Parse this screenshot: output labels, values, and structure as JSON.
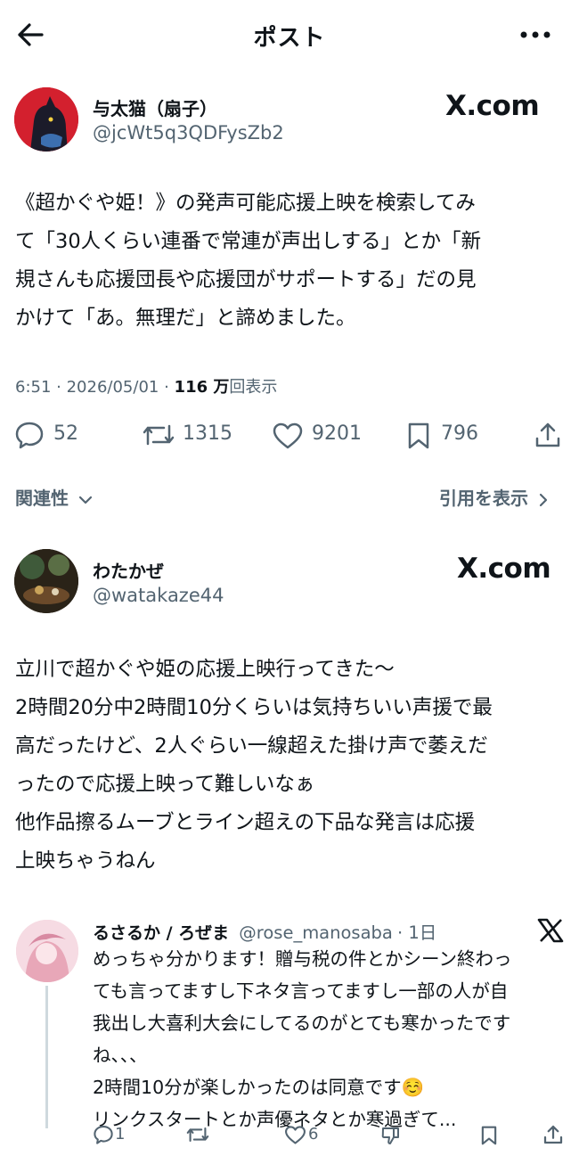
{
  "header": {
    "title": "ポスト"
  },
  "post": {
    "author": {
      "name": "与太猫（扇子）",
      "handle": "@jcWt5q3QDFysZb2"
    },
    "brand": "X.com",
    "lines": [
      "《超かぐや姫！》の発声可能応援上映を検索してみ",
      "て「30人くらい連番で常連が声出しする」とか「新",
      "規さんも応援団長や応援団がサポートする」だの見",
      "かけて「あ。無理だ」と諦めました。"
    ],
    "time": "6:51",
    "date": "2026/05/01",
    "views_count": "116 万",
    "views_label": "回表示",
    "stats": {
      "replies": "52",
      "reposts": "1315",
      "likes": "9201",
      "bookmarks": "796"
    }
  },
  "related": {
    "label": "関連性",
    "quotes_link": "引用を表示"
  },
  "quote": {
    "author": {
      "name": "わたかぜ",
      "handle": "@watakaze44"
    },
    "brand": "X.com",
    "lines": [
      "立川で超かぐや姫の応援上映行ってきた〜",
      "2時間20分中2時間10分くらいは気持ちいい声援で最",
      "高だったけど、2人ぐらい一線超えた掛け声で萎えだ",
      "ったので応援上映って難しいなぁ",
      "他作品擦るムーブとライン超えの下品な発言は応援",
      "上映ちゃうねん"
    ]
  },
  "reply": {
    "author": {
      "name": "るさるか / ろぜま",
      "handle": "@rose_manosaba",
      "time": "· 1日"
    },
    "lines": [
      "めっちゃ分かります！贈与税の件とかシーン終わっ",
      "ても言ってますし下ネタ言ってますし一部の人が自",
      "我出し大喜利大会にしてるのがとても寒かったです",
      "ね、、、",
      "2時間10分が楽しかったのは同意です☺️",
      "リンクスタートとか声優ネタとか寒過ぎて..."
    ],
    "stats": {
      "replies": "1",
      "likes": "6"
    }
  },
  "colors": {
    "text": "#0f1419",
    "secondary": "#536471",
    "background": "#ffffff"
  },
  "icons": [
    "back-arrow-icon",
    "more-icon",
    "reply-icon",
    "repost-icon",
    "like-icon",
    "bookmark-icon",
    "share-icon",
    "chevron-down-icon",
    "chevron-right-icon",
    "x-logo-icon",
    "dislike-icon"
  ]
}
